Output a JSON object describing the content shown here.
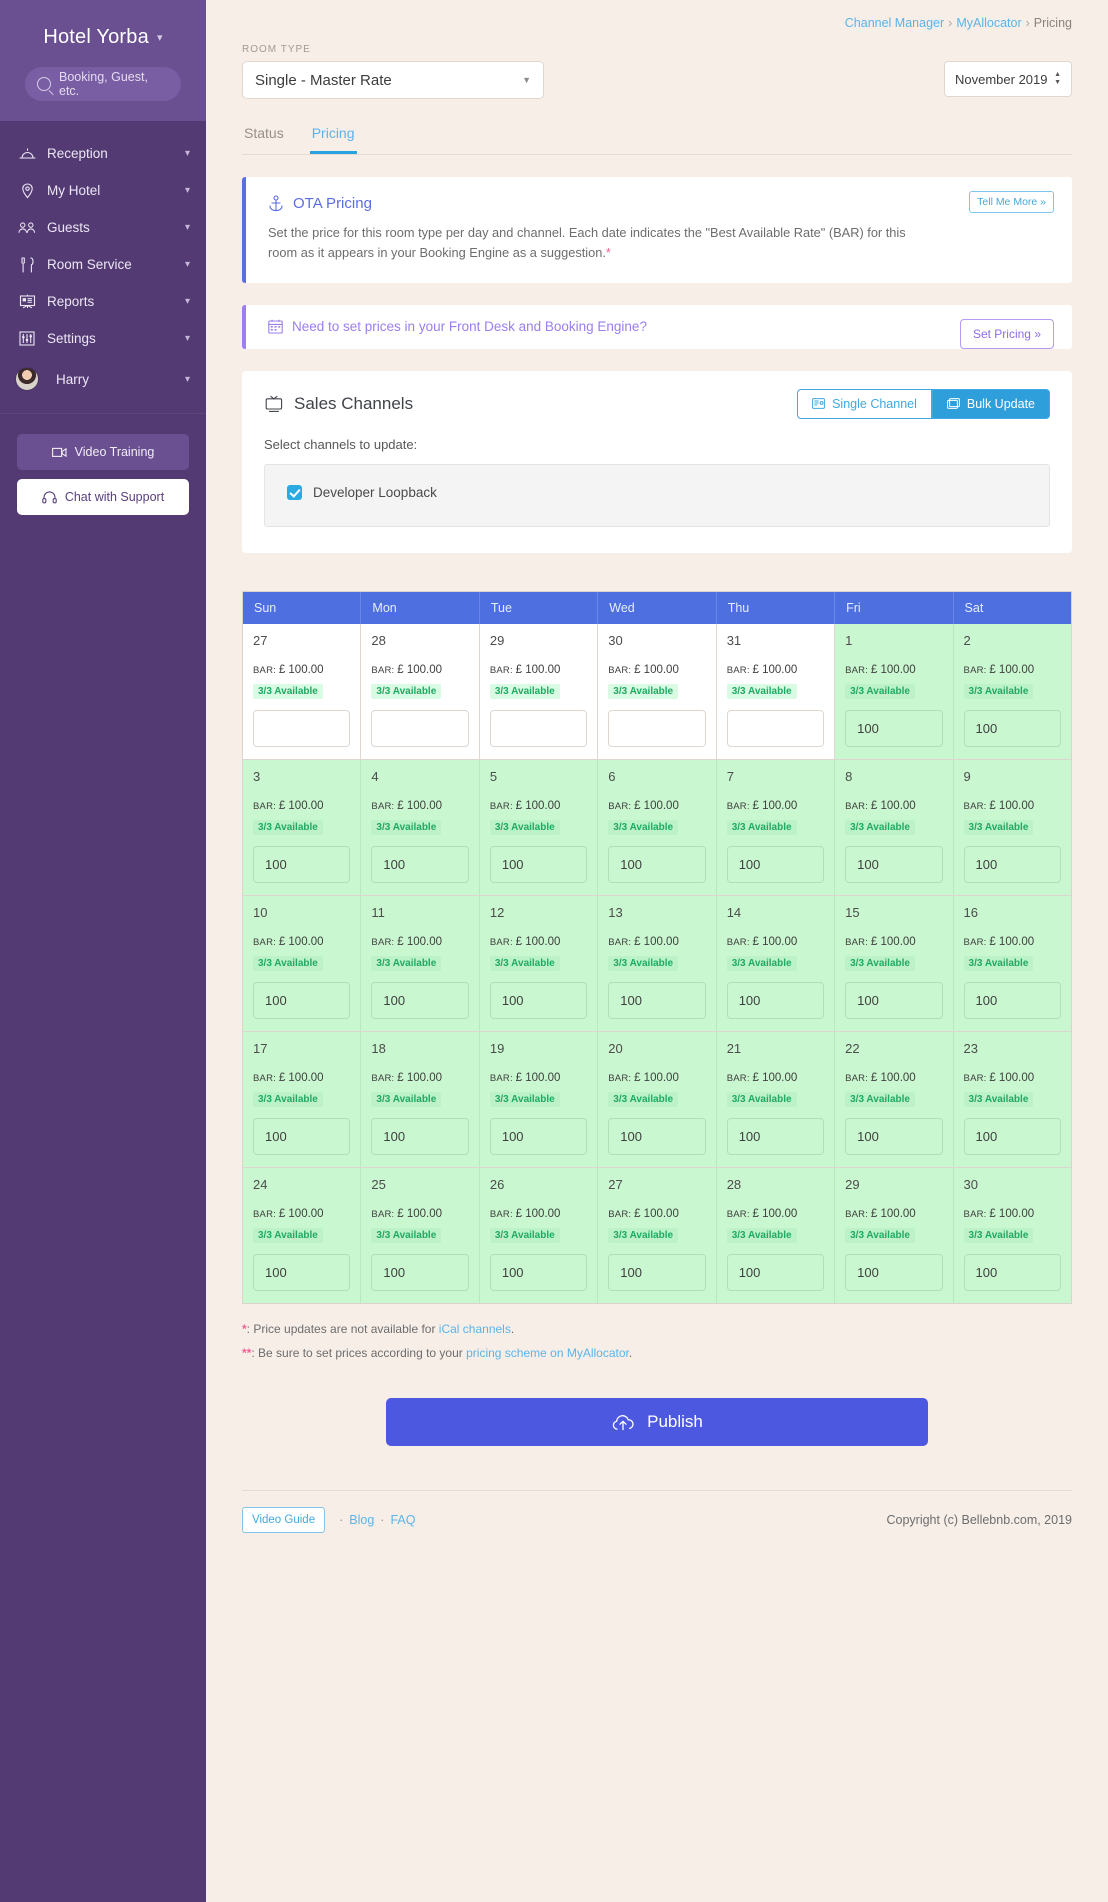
{
  "sidebar": {
    "brand": "Hotel Yorba",
    "search_placeholder": "Booking, Guest, etc.",
    "items": [
      {
        "label": "Reception",
        "icon": "bell-icon"
      },
      {
        "label": "My Hotel",
        "icon": "location-pin-icon"
      },
      {
        "label": "Guests",
        "icon": "guests-icon"
      },
      {
        "label": "Room Service",
        "icon": "cutlery-icon"
      },
      {
        "label": "Reports",
        "icon": "presentation-icon"
      },
      {
        "label": "Settings",
        "icon": "sliders-icon"
      },
      {
        "label": "Harry",
        "icon": "avatar"
      }
    ],
    "video_training": "Video Training",
    "chat_support": "Chat with Support"
  },
  "breadcrumb": {
    "item1": "Channel Manager",
    "item2": "MyAllocator",
    "current": "Pricing",
    "sep": "›"
  },
  "topbar": {
    "room_type_label": "ROOM TYPE",
    "room_type_value": "Single - Master Rate",
    "month_value": "November 2019"
  },
  "tabs": [
    {
      "label": "Status",
      "active": false
    },
    {
      "label": "Pricing",
      "active": true
    }
  ],
  "ota_panel": {
    "title": "OTA Pricing",
    "body": "Set the price for this room type per day and channel. Each date indicates the \"Best Available Rate\" (BAR) for this room as it appears in your Booking Engine as a suggestion.",
    "asterisk": "*",
    "button": "Tell Me More »"
  },
  "frontdesk_panel": {
    "title": "Need to set prices in your Front Desk and Booking Engine?",
    "button": "Set Pricing »"
  },
  "sales_channels": {
    "title": "Sales Channels",
    "single_channel": "Single Channel",
    "bulk_update": "Bulk Update",
    "select_label": "Select channels to update:",
    "channels": [
      {
        "name": "Developer Loopback",
        "checked": true
      }
    ]
  },
  "calendar": {
    "headers": [
      "Sun",
      "Mon",
      "Tue",
      "Wed",
      "Thu",
      "Fri",
      "Sat"
    ],
    "bar_label": "BAR:",
    "currency": "£",
    "bar_price": "100.00",
    "availability": "3/3 Available",
    "rows": [
      [
        {
          "day": "27",
          "other_month": true,
          "price": ""
        },
        {
          "day": "28",
          "other_month": true,
          "price": ""
        },
        {
          "day": "29",
          "other_month": true,
          "price": ""
        },
        {
          "day": "30",
          "other_month": true,
          "price": ""
        },
        {
          "day": "31",
          "other_month": true,
          "price": ""
        },
        {
          "day": "1",
          "other_month": false,
          "price": "100"
        },
        {
          "day": "2",
          "other_month": false,
          "price": "100"
        }
      ],
      [
        {
          "day": "3",
          "other_month": false,
          "price": "100"
        },
        {
          "day": "4",
          "other_month": false,
          "price": "100"
        },
        {
          "day": "5",
          "other_month": false,
          "price": "100"
        },
        {
          "day": "6",
          "other_month": false,
          "price": "100"
        },
        {
          "day": "7",
          "other_month": false,
          "price": "100"
        },
        {
          "day": "8",
          "other_month": false,
          "price": "100"
        },
        {
          "day": "9",
          "other_month": false,
          "price": "100"
        }
      ],
      [
        {
          "day": "10",
          "other_month": false,
          "price": "100"
        },
        {
          "day": "11",
          "other_month": false,
          "price": "100"
        },
        {
          "day": "12",
          "other_month": false,
          "price": "100"
        },
        {
          "day": "13",
          "other_month": false,
          "price": "100"
        },
        {
          "day": "14",
          "other_month": false,
          "price": "100"
        },
        {
          "day": "15",
          "other_month": false,
          "price": "100"
        },
        {
          "day": "16",
          "other_month": false,
          "price": "100"
        }
      ],
      [
        {
          "day": "17",
          "other_month": false,
          "price": "100"
        },
        {
          "day": "18",
          "other_month": false,
          "price": "100"
        },
        {
          "day": "19",
          "other_month": false,
          "price": "100"
        },
        {
          "day": "20",
          "other_month": false,
          "price": "100"
        },
        {
          "day": "21",
          "other_month": false,
          "price": "100"
        },
        {
          "day": "22",
          "other_month": false,
          "price": "100"
        },
        {
          "day": "23",
          "other_month": false,
          "price": "100"
        }
      ],
      [
        {
          "day": "24",
          "other_month": false,
          "price": "100"
        },
        {
          "day": "25",
          "other_month": false,
          "price": "100"
        },
        {
          "day": "26",
          "other_month": false,
          "price": "100"
        },
        {
          "day": "27",
          "other_month": false,
          "price": "100"
        },
        {
          "day": "28",
          "other_month": false,
          "price": "100"
        },
        {
          "day": "29",
          "other_month": false,
          "price": "100"
        },
        {
          "day": "30",
          "other_month": false,
          "price": "100"
        }
      ]
    ]
  },
  "notes": {
    "note1_mark": "*",
    "note1_text": ": Price updates are not available for ",
    "note1_link": "iCal channels",
    "note1_end": ".",
    "note2_mark": "**",
    "note2_text": ": Be sure to set prices according to your ",
    "note2_link": "pricing scheme on MyAllocator",
    "note2_end": "."
  },
  "publish": {
    "label": "Publish"
  },
  "footer": {
    "video_guide": "Video Guide",
    "dot1": "·",
    "blog": "Blog",
    "dot2": "·",
    "faq": "FAQ",
    "copyright": "Copyright (c) Bellebnb.com, 2019"
  },
  "colors": {
    "sidebar": "#533a72",
    "accent_blue": "#29abe2",
    "calendar_header": "#4d6fe0",
    "publish": "#4d58e0",
    "available_green": "#1faa63"
  }
}
